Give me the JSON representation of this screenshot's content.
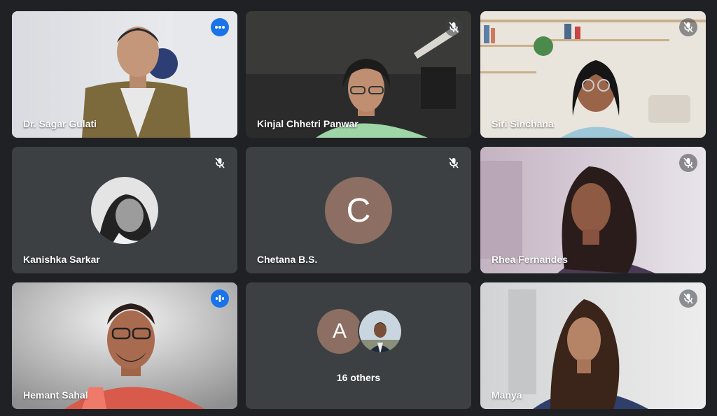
{
  "participants": [
    {
      "name": "Dr. Sagar Gulati",
      "status": "more-options-icon"
    },
    {
      "name": "Kinjal Chhetri Panwar",
      "status": "mic-off-icon"
    },
    {
      "name": "Siri Sinchana",
      "status": "mic-off-icon"
    },
    {
      "name": "Kanishka Sarkar",
      "status": "mic-off-icon"
    },
    {
      "name": "Chetana B.S.",
      "status": "mic-off-icon",
      "avatar_letter": "C",
      "avatar_color": "#8d6e63"
    },
    {
      "name": "Rhea Fernandes",
      "status": "mic-off-icon"
    },
    {
      "name": "Hemant Sahal",
      "status": "speaking-icon"
    },
    {
      "name": "Manya",
      "status": "mic-off-icon"
    }
  ],
  "others": {
    "label": "16 others",
    "avatar_letter": "A",
    "avatar_color": "#8d6e63"
  },
  "colors": {
    "background": "#202124",
    "tile": "#3c4043",
    "accent": "#1a73e8",
    "active_border": "#8ab4f8"
  }
}
